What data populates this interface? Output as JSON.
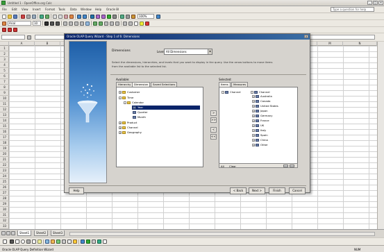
{
  "window": {
    "title": "Untitled 1 - OpenOffice.org Calc",
    "help_placeholder": "Type a question for help"
  },
  "menu": [
    "File",
    "Edit",
    "View",
    "Insert",
    "Format",
    "Tools",
    "Data",
    "Window",
    "Help",
    "Oracle BI"
  ],
  "toolbar": {
    "font_name": "Arial",
    "font_size": "10",
    "zoom": "100%"
  },
  "columns": [
    "A",
    "B",
    "C",
    "D",
    "E",
    "F",
    "G",
    "H",
    "I",
    "J",
    "K",
    "L",
    "M",
    "N"
  ],
  "rows": [
    "1",
    "2",
    "3",
    "4",
    "5",
    "6",
    "7",
    "8",
    "9",
    "10",
    "11",
    "12",
    "13",
    "14",
    "15",
    "16",
    "17",
    "18",
    "19",
    "20",
    "21",
    "22",
    "23",
    "24",
    "25",
    "26",
    "27",
    "28",
    "29",
    "30",
    "31",
    "32",
    "33"
  ],
  "sheet_tabs": [
    "Sheet1",
    "Sheet2",
    "Sheet3"
  ],
  "status": {
    "left": "Oracle OLAP Query Definition Wizard",
    "right": "NUM"
  },
  "dialog": {
    "title": "Oracle OLAP Query Wizard - Step 1 of 6: Dimensions",
    "step_title": "Dimensions",
    "measure_label": "Level",
    "measure_value": "All Dimensions",
    "description_line1": "Select the dimensions, hierarchies, and levels that you want to display in the query. Use the arrow buttons to move items",
    "description_line2": "from the available list to the selected list.",
    "available": {
      "label": "Available:",
      "tabs": [
        "Hierarchy",
        "Dimension",
        "Saved Selections"
      ],
      "items": [
        {
          "label": "Customer",
          "indent": 0,
          "type": "folder",
          "expander": "+"
        },
        {
          "label": "Time",
          "indent": 0,
          "type": "folder",
          "expander": "-"
        },
        {
          "label": "Calendar",
          "indent": 1,
          "type": "folder",
          "expander": "-"
        },
        {
          "label": "Year",
          "indent": 2,
          "type": "dim",
          "expander": "",
          "selected": true
        },
        {
          "label": "Quarter",
          "indent": 2,
          "type": "dim",
          "expander": ""
        },
        {
          "label": "Month",
          "indent": 2,
          "type": "dim",
          "expander": ""
        },
        {
          "label": "Product",
          "indent": 0,
          "type": "folder",
          "expander": "+"
        },
        {
          "label": "Channel",
          "indent": 0,
          "type": "folder",
          "expander": "+"
        },
        {
          "label": "Geography",
          "indent": 0,
          "type": "folder",
          "expander": "+"
        }
      ]
    },
    "selected": {
      "label": "Selected:",
      "tabs": [
        "Items",
        "Measures"
      ],
      "root": "Channel",
      "root_child": "Channel",
      "items": [
        "Australia",
        "Canada",
        "United States",
        "Japan",
        "Germany",
        "France",
        "UK",
        "Italy",
        "Spain",
        "China",
        "Other"
      ],
      "footer_left": "All",
      "footer_label": "Clear"
    },
    "move_buttons": [
      ">",
      ">>",
      "<",
      "<<"
    ],
    "buttons": {
      "help": "Help",
      "back": "< Back",
      "next": "Next >",
      "finish": "Finish",
      "cancel": "Cancel"
    }
  }
}
